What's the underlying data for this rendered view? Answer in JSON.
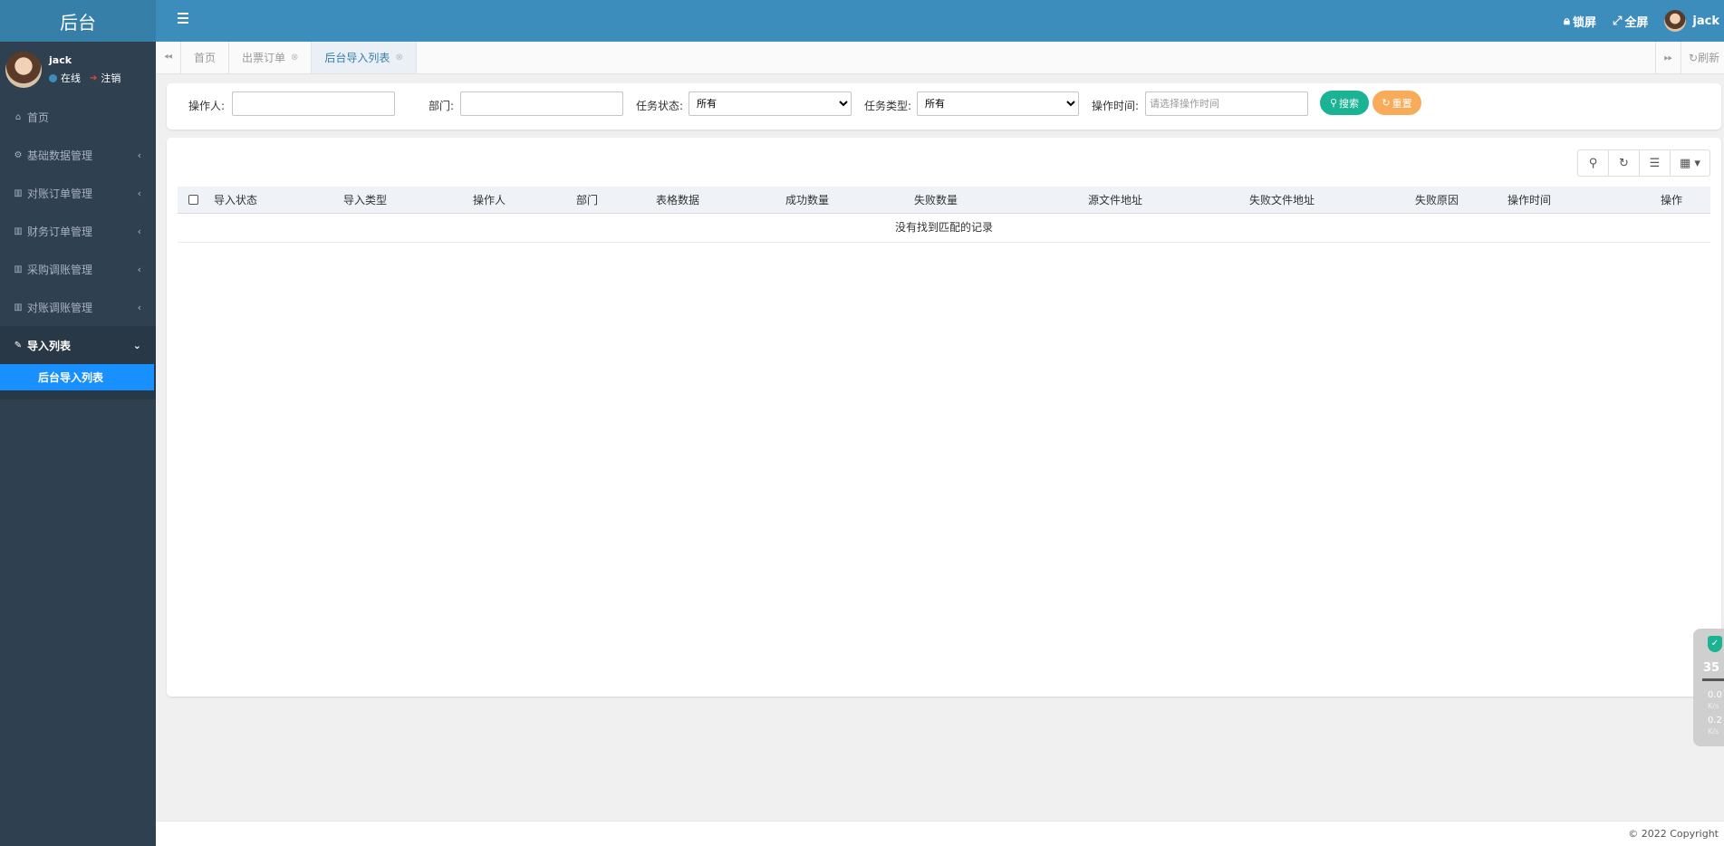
{
  "sidebar": {
    "logo": "后台",
    "user": {
      "name": "jack",
      "status_online": "在线",
      "logout": "注销"
    },
    "items": [
      {
        "label": "首页",
        "icon": "home-icon",
        "glyph": "⌂",
        "has_children": false
      },
      {
        "label": "基础数据管理",
        "icon": "cogs-icon",
        "glyph": "⚙",
        "has_children": true
      },
      {
        "label": "对账订单管理",
        "icon": "bar-chart-icon",
        "glyph": "▥",
        "has_children": true
      },
      {
        "label": "财务订单管理",
        "icon": "bar-chart-icon",
        "glyph": "▥",
        "has_children": true
      },
      {
        "label": "采购调账管理",
        "icon": "bar-chart-icon",
        "glyph": "▥",
        "has_children": true
      },
      {
        "label": "对账调账管理",
        "icon": "bar-chart-icon",
        "glyph": "▥",
        "has_children": true
      },
      {
        "label": "导入列表",
        "icon": "wrench-icon",
        "glyph": "✎",
        "has_children": true,
        "active": true
      }
    ],
    "sub_items": [
      {
        "label": "后台导入列表",
        "active": true
      }
    ]
  },
  "header": {
    "lock_label": "锁屏",
    "fullscreen_label": "全屏",
    "user_name": "jack"
  },
  "tabs": {
    "items": [
      {
        "label": "首页",
        "closable": false,
        "active": false
      },
      {
        "label": "出票订单",
        "closable": true,
        "active": false
      },
      {
        "label": "后台导入列表",
        "closable": true,
        "active": true
      }
    ],
    "refresh_label": "刷新"
  },
  "search": {
    "operator_label": "操作人:",
    "operator_value": "",
    "department_label": "部门:",
    "department_value": "",
    "task_status_label": "任务状态:",
    "task_status_value": "所有",
    "task_type_label": "任务类型:",
    "task_type_value": "所有",
    "op_time_label": "操作时间:",
    "op_time_placeholder": "请选择操作时间",
    "search_button": "搜索",
    "reset_button": "重置"
  },
  "table": {
    "columns": [
      "导入状态",
      "导入类型",
      "操作人",
      "部门",
      "表格数据",
      "成功数量",
      "失败数量",
      "源文件地址",
      "失败文件地址",
      "失败原因",
      "操作时间",
      "操作"
    ],
    "empty_text": "没有找到匹配的记录"
  },
  "footer": {
    "copyright": "© 2022 Copyright"
  },
  "widget": {
    "value": "35",
    "up_speed": "0.0",
    "down_speed": "0.2",
    "unit": "K/s"
  },
  "colors": {
    "sidebar_bg": "#2f4050",
    "header_bg": "#3c8dbc",
    "active_submenu": "#1890ff",
    "search_button": "#1ab394",
    "reset_button": "#f8ac59"
  }
}
